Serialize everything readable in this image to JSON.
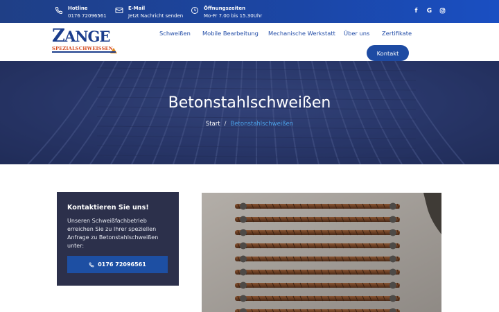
{
  "topbar": {
    "items": [
      {
        "icon": "phone-icon",
        "title": "Hotline",
        "value": "0176 72096561"
      },
      {
        "icon": "mail-icon",
        "title": "E-Mail",
        "value": "Jetzt Nachricht senden"
      },
      {
        "icon": "clock-icon",
        "title": "Öffnungszeiten",
        "value": "Mo-Fr 7.00 bis 15.30Uhr"
      }
    ],
    "social": {
      "facebook": "f",
      "google": "G",
      "instagram": "instagram-icon"
    },
    "colors": {
      "bg_start": "#1f3f86",
      "bg_end": "#1a4fc2"
    }
  },
  "header": {
    "logo": {
      "word": "ZANGE",
      "sub": "SPEZIALSCHWEISSEN"
    },
    "nav": [
      "Schweißen",
      "Mobile Bearbeitung",
      "Mechanische Werkstatt",
      "Über uns",
      "Zertifikate"
    ],
    "cta": "Kontakt"
  },
  "hero": {
    "title": "Betonstahlschweißen",
    "breadcrumb": {
      "start": "Start",
      "separator": "/",
      "current": "Betonstahlschweißen"
    }
  },
  "contact_card": {
    "title": "Kontaktieren Sie uns!",
    "text": "Unseren Schweißfachbetrieb erreichen Sie zu Ihrer speziellen Anfrage zu Betonstahlschweißen unter:",
    "button": "0176 72096561"
  },
  "colors": {
    "accent": "#1e4ba3",
    "card": "#2c304b",
    "crumb_active": "#4aa0e6"
  }
}
